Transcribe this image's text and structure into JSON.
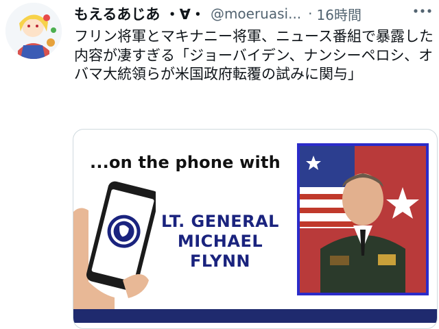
{
  "tweet": {
    "display_name": "もえるあじあ ・∀・",
    "handle": "@moeruasi...",
    "separator": "·",
    "time": "16時間",
    "more_icon": "more-horizontal-icon",
    "text": "フリン将軍とマキナニー将軍、ニュース番組で暴露した内容が凄すぎる「ジョーバイデン、ナンシーペロシ、オバマ大統領らが米国政府転覆の試みに関与」"
  },
  "media": {
    "caption": "...on the phone with",
    "guest_line1": "LT. GENERAL",
    "guest_line2": "MICHAEL FLYNN",
    "accent_color": "#1a237e",
    "frame_color": "#2b2bc9"
  }
}
